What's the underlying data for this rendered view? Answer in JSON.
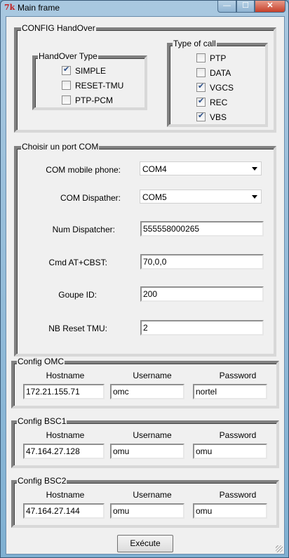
{
  "window": {
    "title": "Main frame",
    "icon": "tk-feather-icon",
    "controls": {
      "minimize": "—",
      "maximize": "☐",
      "close": "✕"
    }
  },
  "config_handover": {
    "legend": "CONFIG HandOver",
    "handover_type": {
      "legend": "HandOver Type",
      "options": [
        {
          "label": "SIMPLE",
          "checked": true
        },
        {
          "label": "RESET-TMU",
          "checked": false
        },
        {
          "label": "PTP-PCM",
          "checked": false
        }
      ]
    },
    "type_of_call": {
      "legend": "Type of call",
      "options": [
        {
          "label": "PTP",
          "checked": false
        },
        {
          "label": "DATA",
          "checked": false
        },
        {
          "label": "VGCS",
          "checked": true
        },
        {
          "label": "REC",
          "checked": true
        },
        {
          "label": "VBS",
          "checked": true
        }
      ]
    }
  },
  "com_port": {
    "legend": "Choisir un port COM",
    "mobile_phone": {
      "label": "COM mobile phone:",
      "value": "COM4"
    },
    "dispatcher": {
      "label": "COM Dispather:",
      "value": "COM5"
    },
    "num_dispatcher": {
      "label": "Num Dispatcher:",
      "value": "555558000265"
    },
    "cmd_cbst": {
      "label": "Cmd AT+CBST:",
      "value": "70,0,0"
    },
    "groupe_id": {
      "label": "Goupe ID:",
      "value": "200"
    },
    "nb_reset_tmu": {
      "label": "NB Reset TMU:",
      "value": "2"
    }
  },
  "columns": {
    "hostname": "Hostname",
    "username": "Username",
    "password": "Password"
  },
  "config_omc": {
    "legend": "Config OMC",
    "hostname": "172.21.155.71",
    "username": "omc",
    "password": "nortel"
  },
  "config_bsc1": {
    "legend": "Config BSC1",
    "hostname": "47.164.27.128",
    "username": "omu",
    "password": "omu"
  },
  "config_bsc2": {
    "legend": "Config BSC2",
    "hostname": "47.164.27.144",
    "username": "omu",
    "password": "omu"
  },
  "execute_button": "Exécute"
}
